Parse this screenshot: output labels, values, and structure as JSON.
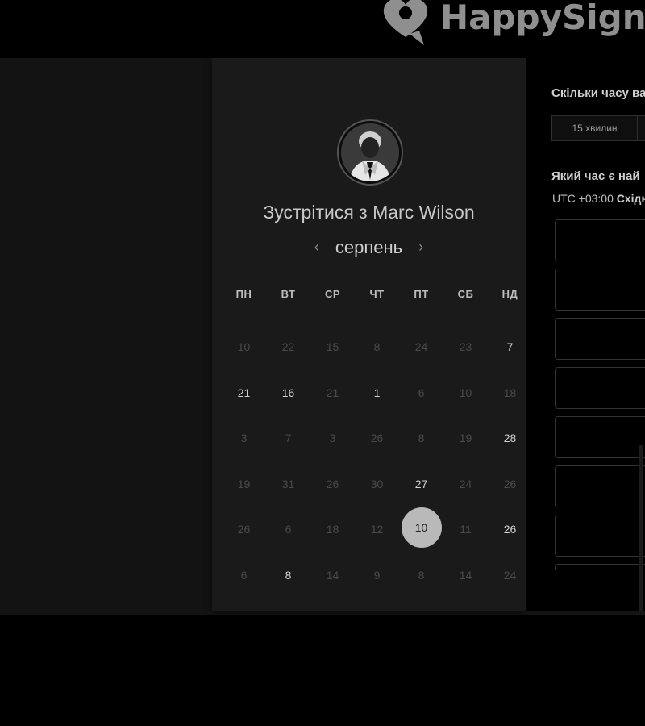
{
  "header": {
    "brand": "HappySignals"
  },
  "calendar": {
    "host_title": "Зустрітися з Marc Wilson",
    "month": "серпень",
    "prev_label": "‹",
    "next_label": "›",
    "weekdays": [
      "ПН",
      "ВТ",
      "СР",
      "ЧТ",
      "ПТ",
      "СБ",
      "НД"
    ],
    "weeks": [
      [
        {
          "d": "10",
          "a": false
        },
        {
          "d": "22",
          "a": false
        },
        {
          "d": "15",
          "a": false
        },
        {
          "d": "8",
          "a": false
        },
        {
          "d": "24",
          "a": false
        },
        {
          "d": "23",
          "a": false
        },
        {
          "d": "7",
          "a": true
        }
      ],
      [
        {
          "d": "21",
          "a": true
        },
        {
          "d": "16",
          "a": true
        },
        {
          "d": "21",
          "a": false
        },
        {
          "d": "1",
          "a": true
        },
        {
          "d": "6",
          "a": false
        },
        {
          "d": "10",
          "a": false
        },
        {
          "d": "18",
          "a": false
        }
      ],
      [
        {
          "d": "3",
          "a": false
        },
        {
          "d": "7",
          "a": false
        },
        {
          "d": "3",
          "a": false
        },
        {
          "d": "26",
          "a": false
        },
        {
          "d": "8",
          "a": false
        },
        {
          "d": "19",
          "a": false
        },
        {
          "d": "28",
          "a": true
        }
      ],
      [
        {
          "d": "19",
          "a": false
        },
        {
          "d": "31",
          "a": false
        },
        {
          "d": "26",
          "a": false
        },
        {
          "d": "30",
          "a": false
        },
        {
          "d": "27",
          "a": true
        },
        {
          "d": "24",
          "a": false
        },
        {
          "d": "26",
          "a": false
        }
      ],
      [
        {
          "d": "26",
          "a": false
        },
        {
          "d": "6",
          "a": false
        },
        {
          "d": "18",
          "a": false
        },
        {
          "d": "12",
          "a": false
        },
        {
          "d": "10",
          "a": true,
          "s": true
        },
        {
          "d": "11",
          "a": false
        },
        {
          "d": "26",
          "a": true
        }
      ],
      [
        {
          "d": "6",
          "a": false
        },
        {
          "d": "8",
          "a": true
        },
        {
          "d": "14",
          "a": false
        },
        {
          "d": "9",
          "a": false
        },
        {
          "d": "8",
          "a": false
        },
        {
          "d": "14",
          "a": false
        },
        {
          "d": "24",
          "a": false
        }
      ]
    ]
  },
  "booking": {
    "duration_question": "Скільки часу ва",
    "durations": [
      "15 хвилин",
      ""
    ],
    "time_question": "Який час є най",
    "timezone_offset": "UTC +03:00",
    "timezone_name": "Східн",
    "slot_count": 8
  },
  "colors": {
    "background": "#000000",
    "card": "#1a1a1a",
    "selected_day": "#b9b9b9"
  }
}
